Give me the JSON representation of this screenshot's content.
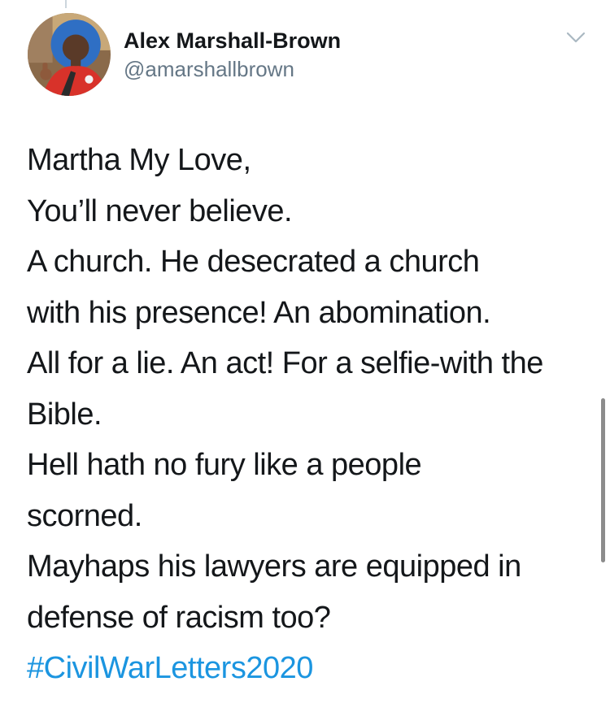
{
  "tweet": {
    "author": {
      "display_name": "Alex Marshall-Brown",
      "handle": "@amarshallbrown"
    },
    "menu_icon": "chevron-down-icon",
    "text_lines": [
      "Martha My Love,",
      "You’ll never believe.",
      "A church. He desecrated a church",
      "with his presence! An abomination.",
      "All for a lie. An act! For a selfie-with the",
      "Bible.",
      "Hell hath no fury like a people",
      "scorned.",
      "Mayhaps his lawyers are equipped in",
      "defense of racism too?"
    ],
    "hashtag": "#CivilWarLetters2020"
  },
  "colors": {
    "text": "#14171a",
    "secondary_text": "#657786",
    "link": "#1b95e0",
    "chevron": "#aab8c2",
    "scrollbar": "#8c8c8c"
  }
}
